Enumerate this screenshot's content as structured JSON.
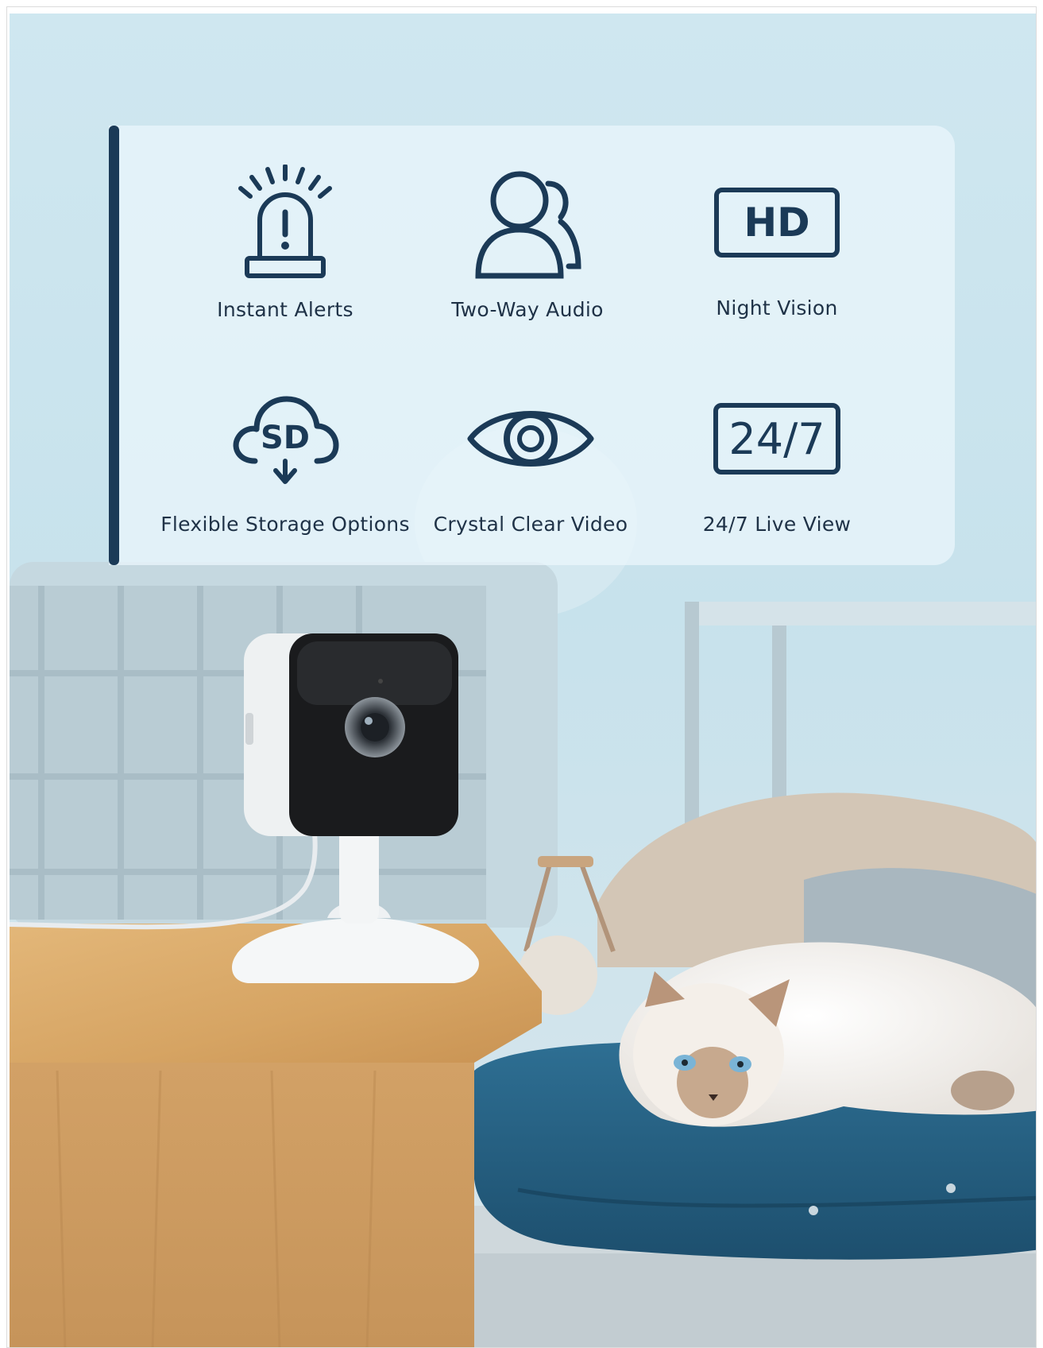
{
  "features": [
    {
      "icon": "siren-alert-icon",
      "label": "Instant Alerts"
    },
    {
      "icon": "two-people-icon",
      "label": "Two-Way Audio"
    },
    {
      "icon": "hd-badge-icon",
      "label": "Night Vision",
      "badge": "HD"
    },
    {
      "icon": "sd-cloud-icon",
      "label": "Flexible Storage Options",
      "badge": "SD"
    },
    {
      "icon": "eye-icon",
      "label": "Crystal Clear Video"
    },
    {
      "icon": "24-7-badge-icon",
      "label": "24/7 Live View",
      "badge": "24/7"
    }
  ],
  "colors": {
    "accent": "#1b3a57",
    "text": "#1f3247",
    "panel": "#ebf6fc",
    "background_sky": "#d3e9f1"
  }
}
